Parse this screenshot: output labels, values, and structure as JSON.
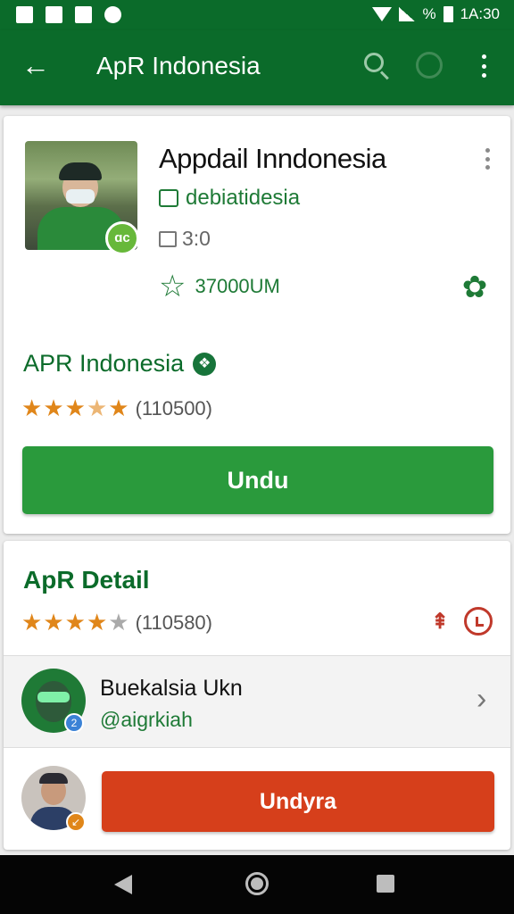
{
  "status_bar": {
    "battery_text": "%",
    "time": "1A:30"
  },
  "app_bar": {
    "back_glyph": "←",
    "title": "ApR Indonesia",
    "icons": [
      "arrow-back-icon",
      "search-icon",
      "mic-icon",
      "more-vert-icon"
    ]
  },
  "app_card": {
    "title": "Appdail Inndonesia",
    "photo_badge": "ɑc",
    "developer": "debiatidesia",
    "size": "3:0",
    "downloads": "37000UM",
    "name": "APR Indonesia",
    "verified_glyph": "❖",
    "rating_stars": 3.5,
    "rating_count": "(110500)",
    "install_label": "Undu"
  },
  "detail_card": {
    "title": "ApR Detail",
    "rating_stars": 4,
    "rating_count": "(110580)",
    "developer_name": "Buekalsia Ukn",
    "developer_handle": "@aigrkiah",
    "developer_badge": "2",
    "user_badge": "↙",
    "uninstall_label": "Undyra"
  },
  "colors": {
    "primary": "#0b6b2a",
    "install_button": "#2a9a3c",
    "uninstall_button": "#d63f1b",
    "star": "#e0861a"
  }
}
